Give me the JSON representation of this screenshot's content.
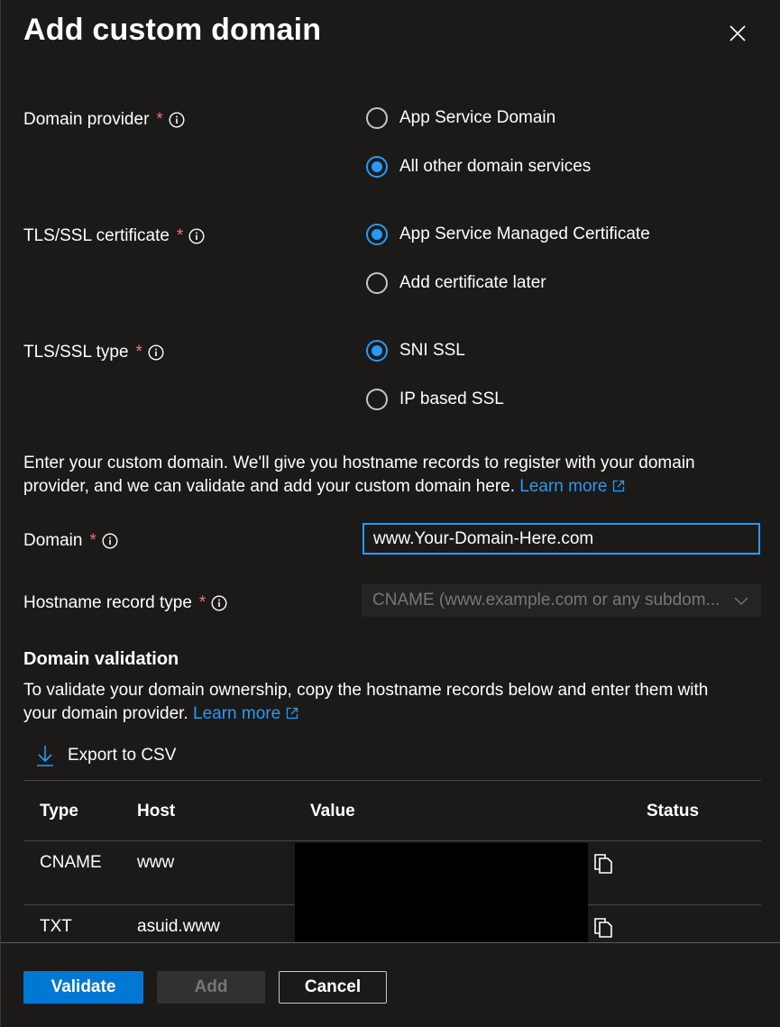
{
  "header": {
    "title": "Add custom domain"
  },
  "fields": {
    "domain_provider": {
      "label": "Domain provider",
      "required": "*",
      "options": [
        "App Service Domain",
        "All other domain services"
      ],
      "selected": "All other domain services"
    },
    "tls_certificate": {
      "label": "TLS/SSL certificate",
      "required": "*",
      "options": [
        "App Service Managed Certificate",
        "Add certificate later"
      ],
      "selected": "App Service Managed Certificate"
    },
    "tls_type": {
      "label": "TLS/SSL type",
      "required": "*",
      "options": [
        "SNI SSL",
        "IP based SSL"
      ],
      "selected": "SNI SSL"
    },
    "domain": {
      "label": "Domain",
      "required": "*",
      "value": "www.Your-Domain-Here.com"
    },
    "hostname_record_type": {
      "label": "Hostname record type",
      "required": "*",
      "value": "CNAME (www.example.com or any subdom..."
    }
  },
  "intro": {
    "text": "Enter your custom domain. We'll give you hostname records to register with your domain provider, and we can validate and add your custom domain here.",
    "link": "Learn more"
  },
  "validation": {
    "heading": "Domain validation",
    "text": "To validate your domain ownership, copy the hostname records below and enter them with your domain provider.",
    "link": "Learn more",
    "export_label": "Export to CSV",
    "columns": [
      "Type",
      "Host",
      "Value",
      "Status"
    ],
    "rows": [
      {
        "type": "CNAME",
        "host": "www"
      },
      {
        "type": "TXT",
        "host": "asuid.www"
      }
    ]
  },
  "footer": {
    "validate": "Validate",
    "add": "Add",
    "cancel": "Cancel"
  },
  "colors": {
    "accent": "#2899f5",
    "primary_button": "#0078d4",
    "required": "#f1707b",
    "background": "#1b1a19"
  },
  "icons": {
    "close": "close-icon",
    "info": "info-icon",
    "external": "external-link-icon",
    "download": "download-icon",
    "copy": "copy-icon",
    "chevron": "chevron-down-icon"
  }
}
